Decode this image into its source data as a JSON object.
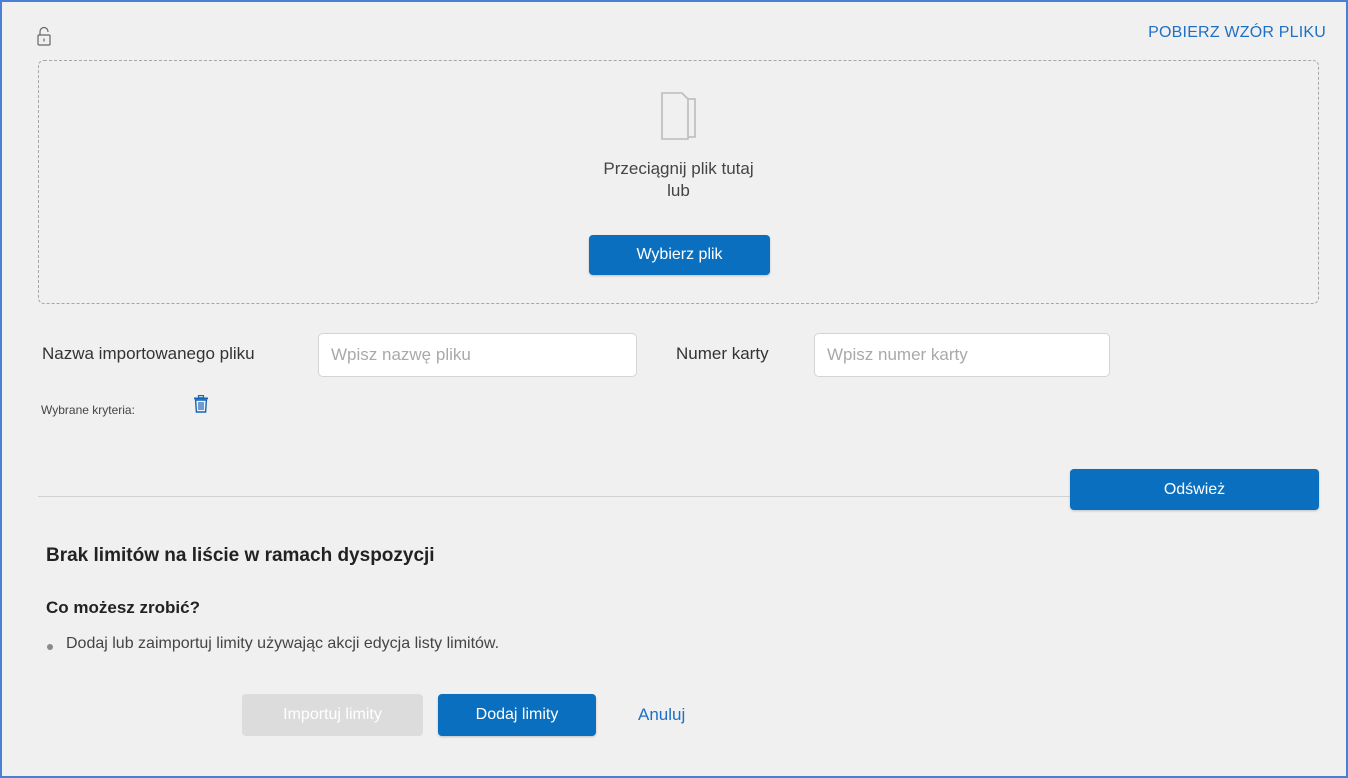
{
  "header": {
    "download_template_label": "POBIERZ WZÓR PLIKU"
  },
  "dropzone": {
    "line1": "Przeciągnij plik tutaj",
    "line2": "lub",
    "choose_file_label": "Wybierz plik"
  },
  "filters": {
    "file_name_label": "Nazwa importowanego pliku",
    "file_name_placeholder": "Wpisz nazwę pliku",
    "file_name_value": "",
    "card_number_label": "Numer karty",
    "card_number_placeholder": "Wpisz numer karty",
    "card_number_value": "",
    "selected_criteria_label": "Wybrane kryteria:",
    "refresh_label": "Odśwież"
  },
  "empty_state": {
    "title": "Brak limitów na liście w ramach dyspozycji",
    "help_title": "Co możesz zrobić?",
    "tips": [
      "Dodaj lub zaimportuj limity używając akcji edycja listy limitów."
    ]
  },
  "actions": {
    "import_label": "Importuj limity",
    "add_label": "Dodaj limity",
    "cancel_label": "Anuluj"
  },
  "icons": {
    "lock": "lock-open-icon",
    "file": "documents-icon",
    "trash": "trash-icon"
  },
  "colors": {
    "primary": "#0a6fbe",
    "link": "#1f6fc5",
    "disabled": "#dcdcdc",
    "background": "#f0f0f0",
    "frame_border": "#4a7fd6"
  }
}
